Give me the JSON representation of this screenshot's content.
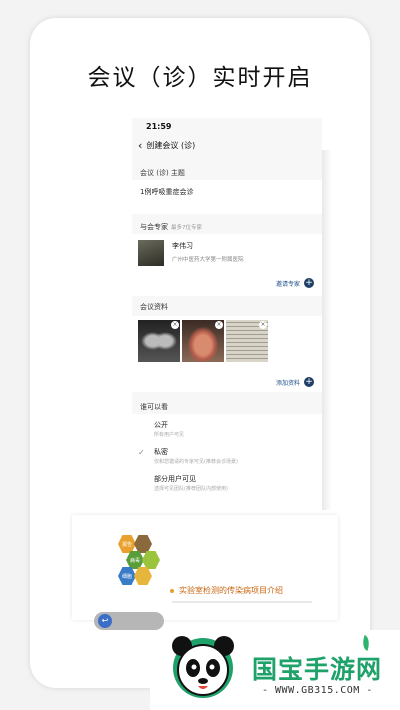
{
  "headline": "会议（诊）实时开启",
  "status_bar": {
    "time": "21:59"
  },
  "nav": {
    "back_icon": "chevron-left-icon",
    "title": "创建会议 (诊)"
  },
  "topic": {
    "label": "会议 (诊) 主题",
    "value": "1例呼吸重症会诊"
  },
  "experts": {
    "label": "与会专家",
    "hint": "最多7位专家",
    "list": [
      {
        "name": "李伟习",
        "org": "广州中医药大学第一附属医院"
      }
    ],
    "invite_label": "邀请专家"
  },
  "materials": {
    "label": "会议资料",
    "images": [
      "chest-xray",
      "tongue-photo",
      "paper-document"
    ],
    "add_label": "添加资料"
  },
  "visibility": {
    "label": "谁可以看",
    "options": [
      {
        "title": "公开",
        "desc": "所有用户可见",
        "selected": false
      },
      {
        "title": "私密",
        "desc": "仅和您邀请的专家可见(推荐会诊场景)",
        "selected": true
      },
      {
        "title": "部分用户可见",
        "desc": "选择可见团队(推荐团队内部使用)",
        "selected": false
      }
    ]
  },
  "overlay": {
    "hex_labels": [
      "报告",
      "病毒",
      "细胞"
    ],
    "caption": "实验室检测的传染病项目介绍"
  },
  "watermark": {
    "brand": "国宝手游网",
    "url": "- WWW.GB315.COM -"
  },
  "colors": {
    "accent": "#1f3f66",
    "link": "#1e4e8c",
    "caption": "#c8650e",
    "brand": "#1fa26a"
  }
}
